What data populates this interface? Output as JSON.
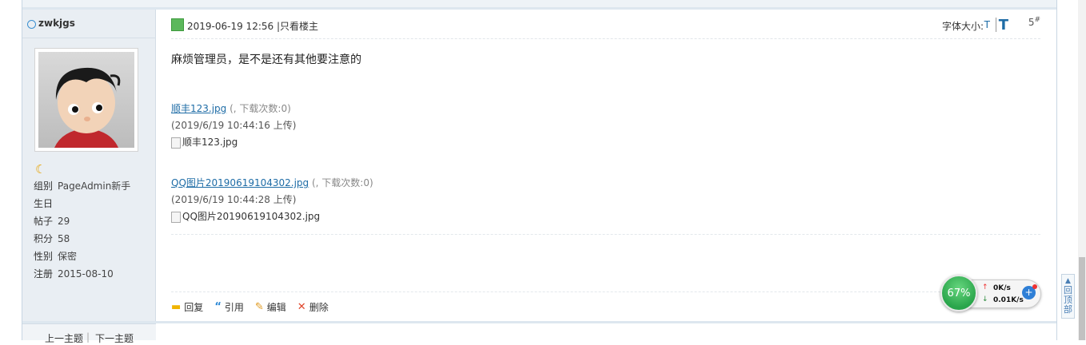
{
  "user": {
    "username": "zwkjgs",
    "info": [
      {
        "label": "组别",
        "value": "PageAdmin新手"
      },
      {
        "label": "生日",
        "value": ""
      },
      {
        "label": "帖子",
        "value": "29"
      },
      {
        "label": "积分",
        "value": "58"
      },
      {
        "label": "性别",
        "value": "保密"
      },
      {
        "label": "注册",
        "value": "2015-08-10"
      }
    ]
  },
  "nav": {
    "prev": "上一主题",
    "sep": "|",
    "next": "下一主题"
  },
  "post": {
    "time": "2019-06-19 12:56",
    "only_author": "|只看楼主",
    "font_size_label": "字体大小:",
    "font_small": "T",
    "font_big": "T",
    "floor": "5",
    "floor_mark": "#",
    "content": "麻烦管理员，是不是还有其他要注意的",
    "attachments": [
      {
        "name": "顺丰123.jpg",
        "meta": "(, 下载次数:0)",
        "date": "(2019/6/19 10:44:16 上传)",
        "alt": "顺丰123.jpg"
      },
      {
        "name": "QQ图片20190619104302.jpg",
        "meta": "(, 下载次数:0)",
        "date": "(2019/6/19 10:44:28 上传)",
        "alt": "QQ图片20190619104302.jpg"
      }
    ],
    "actions": [
      {
        "label": "回复",
        "icon": "reply-icon"
      },
      {
        "label": "引用",
        "icon": "quote-icon"
      },
      {
        "label": "编辑",
        "icon": "edit-icon"
      },
      {
        "label": "删除",
        "icon": "delete-icon"
      }
    ]
  },
  "widget": {
    "percent": "67%",
    "upload": "0K/s",
    "download": "0.01K/s"
  },
  "back_to_top": "回顶部",
  "colors": {
    "accent": "#1e6ca6",
    "sidebar_bg": "#e9eef3",
    "widget_green": "#2aa54b"
  }
}
